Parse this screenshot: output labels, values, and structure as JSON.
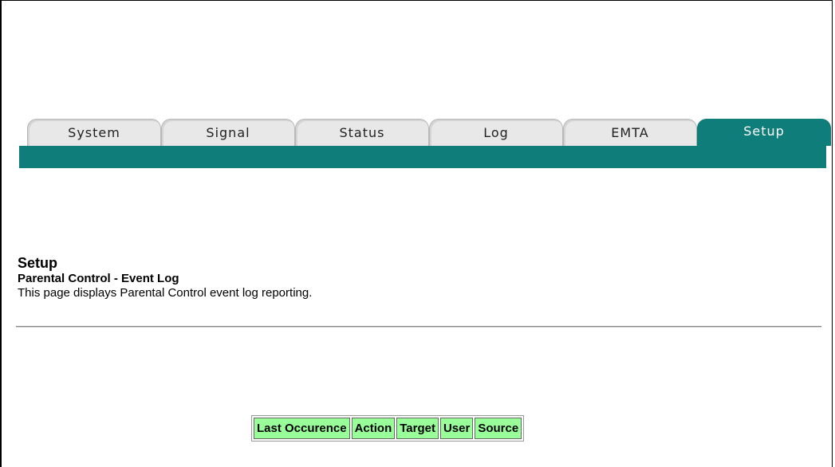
{
  "nav": {
    "tabs": [
      {
        "label": "System",
        "active": false
      },
      {
        "label": "Signal",
        "active": false
      },
      {
        "label": "Status",
        "active": false
      },
      {
        "label": "Log",
        "active": false
      },
      {
        "label": "EMTA",
        "active": false
      },
      {
        "label": "Setup",
        "active": true
      }
    ],
    "accent_color": "#0f7d7a"
  },
  "page": {
    "title": "Setup",
    "section_title": "Parental Control - Event Log",
    "description": "This page displays Parental Control event log reporting."
  },
  "event_log": {
    "header_color": "#99ff99",
    "columns": [
      "Last Occurence",
      "Action",
      "Target",
      "User",
      "Source"
    ],
    "rows": []
  }
}
